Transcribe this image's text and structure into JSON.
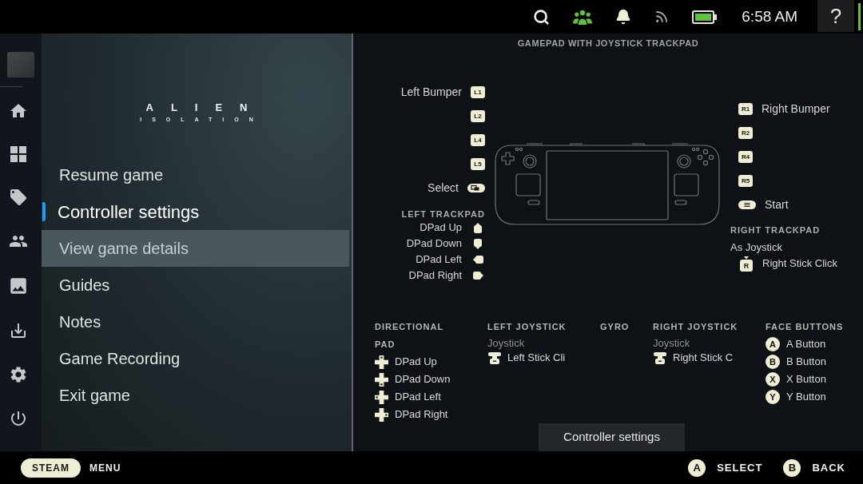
{
  "top_bar": {
    "time": "6:58 AM",
    "help": "?"
  },
  "game_menu": {
    "logo": {
      "title": "ALIEN",
      "subtitle": "ISOLATION"
    },
    "items": [
      {
        "label": "Resume game",
        "selected": false,
        "focused": false
      },
      {
        "label": "Controller settings",
        "selected": true,
        "focused": false
      },
      {
        "label": "View game details",
        "selected": false,
        "focused": true
      },
      {
        "label": "Guides",
        "selected": false,
        "focused": false
      },
      {
        "label": "Notes",
        "selected": false,
        "focused": false
      },
      {
        "label": "Game Recording",
        "selected": false,
        "focused": false
      },
      {
        "label": "Exit game",
        "selected": false,
        "focused": false
      }
    ]
  },
  "controller": {
    "title": "GAMEPAD WITH JOYSTICK TRACKPAD",
    "left_buttons": [
      {
        "kind": "key",
        "key": "L1",
        "label": "Left Bumper"
      },
      {
        "kind": "key",
        "key": "L2"
      },
      {
        "kind": "key",
        "key": "L4"
      },
      {
        "kind": "key",
        "key": "L5"
      },
      {
        "kind": "select",
        "label": "Select"
      }
    ],
    "left_trackpad": {
      "heading": "LEFT TRACKPAD",
      "items": [
        {
          "kind": "up",
          "label": "DPad Up"
        },
        {
          "kind": "down",
          "label": "DPad Down"
        },
        {
          "kind": "left",
          "label": "DPad Left"
        },
        {
          "kind": "right",
          "label": "DPad Right"
        }
      ]
    },
    "right_buttons": [
      {
        "kind": "key",
        "key": "R1",
        "label": "Right Bumper"
      },
      {
        "kind": "key",
        "key": "R2"
      },
      {
        "kind": "key",
        "key": "R4"
      },
      {
        "kind": "key",
        "key": "R5"
      },
      {
        "kind": "start",
        "label": "Start"
      }
    ],
    "right_trackpad": {
      "heading": "RIGHT TRACKPAD",
      "mode": "As Joystick",
      "items": [
        {
          "key": "R",
          "label": "Right Stick Click"
        }
      ]
    },
    "sections": [
      {
        "kind": "dpad",
        "heading": "DIRECTIONAL PAD",
        "items": [
          {
            "kind": "up",
            "label": "DPad Up"
          },
          {
            "kind": "down",
            "label": "DPad Down"
          },
          {
            "kind": "left",
            "label": "DPad Left"
          },
          {
            "kind": "right",
            "label": "DPad Right"
          }
        ]
      },
      {
        "kind": "stick",
        "heading": "LEFT JOYSTICK",
        "mode": "Joystick",
        "items": [
          {
            "label": "Left Stick Cli"
          }
        ]
      },
      {
        "kind": "gyro",
        "heading": "GYRO"
      },
      {
        "kind": "stick",
        "heading": "RIGHT JOYSTICK",
        "mode": "Joystick",
        "items": [
          {
            "label": "Right Stick C"
          }
        ]
      },
      {
        "kind": "face",
        "heading": "FACE BUTTONS",
        "items": [
          {
            "key": "A",
            "label": "A Button"
          },
          {
            "key": "B",
            "label": "B Button"
          },
          {
            "key": "X",
            "label": "X Button"
          },
          {
            "key": "Y",
            "label": "Y Button"
          }
        ]
      }
    ],
    "settings_button": "Controller settings"
  },
  "footer": {
    "steam": "STEAM",
    "menu": "MENU",
    "hints": [
      {
        "key": "A",
        "label": "SELECT"
      },
      {
        "key": "B",
        "label": "BACK"
      }
    ]
  }
}
